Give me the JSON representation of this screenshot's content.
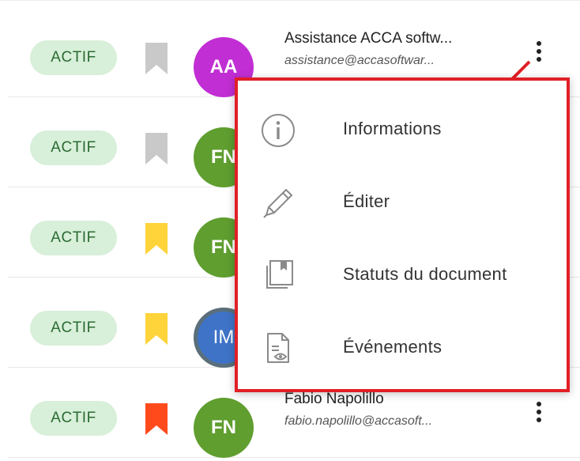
{
  "rows": [
    {
      "status": "ACTIF",
      "bookmark_color": "#c9c9c9",
      "avatar": {
        "initials": "AA",
        "color": "#c12ed4"
      },
      "name": "Assistance ACCA softw...",
      "email": "assistance@accasoftwar..."
    },
    {
      "status": "ACTIF",
      "bookmark_color": "#c9c9c9",
      "avatar": {
        "initials": "FN",
        "color": "#5f9e2f"
      },
      "name": "",
      "email": ""
    },
    {
      "status": "ACTIF",
      "bookmark_color": "#ffd43b",
      "avatar": {
        "initials": "FN",
        "color": "#5f9e2f"
      },
      "name": "",
      "email": ""
    },
    {
      "status": "ACTIF",
      "bookmark_color": "#ffd43b",
      "avatar": {
        "initials": "IM",
        "color": "#3f73c7"
      },
      "name": "",
      "email": ""
    },
    {
      "status": "ACTIF",
      "bookmark_color": "#ff4a1c",
      "avatar": {
        "initials": "FN",
        "color": "#5f9e2f"
      },
      "name": "Fabio Napolillo",
      "email": "fabio.napolillo@accasoft..."
    }
  ],
  "menu": {
    "border_color": "#e21f26",
    "items": [
      {
        "label": "Informations",
        "icon": "info-icon"
      },
      {
        "label": "Éditer",
        "icon": "pencil-icon"
      },
      {
        "label": "Statuts du document",
        "icon": "document-status-icon"
      },
      {
        "label": "Événements",
        "icon": "events-icon"
      }
    ]
  }
}
